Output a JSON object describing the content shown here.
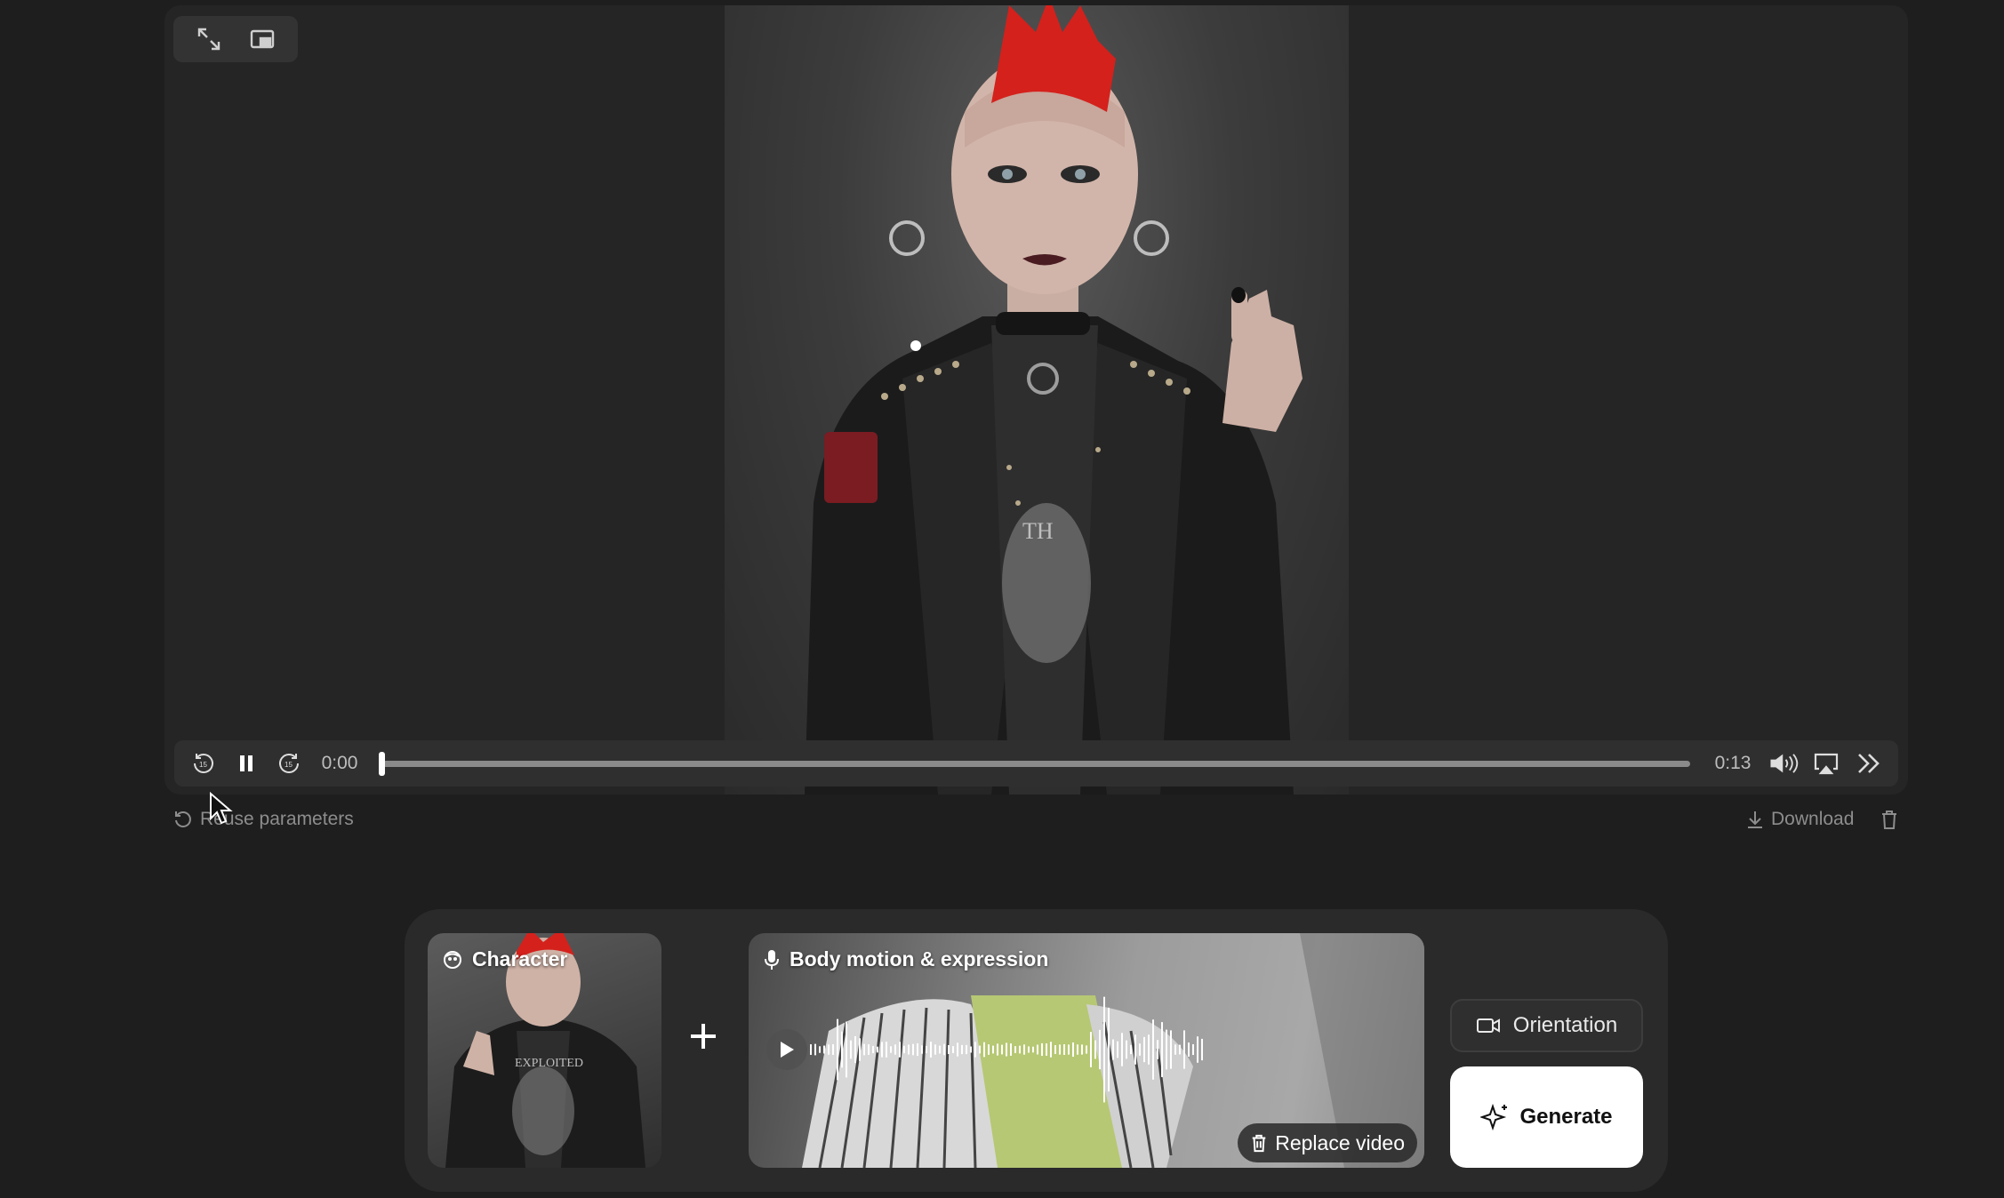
{
  "player": {
    "time_current": "0:00",
    "time_total": "0:13",
    "progress": 0
  },
  "below_player": {
    "reuse_label": "Reuse parameters",
    "download_label": "Download"
  },
  "composer": {
    "character_label": "Character",
    "motion_label": "Body motion & expression",
    "replace_label": "Replace video",
    "orientation_label": "Orientation",
    "generate_label": "Generate",
    "thumbnail_shirt_text": "EXPLOITED"
  },
  "icons": {
    "expand": "expand-icon",
    "pip": "picture-in-picture-icon",
    "rewind": "rewind-15-icon",
    "pause": "pause-icon",
    "forward": "forward-15-icon",
    "volume": "volume-icon",
    "airplay": "airplay-icon",
    "speed": "playback-speed-icon",
    "reuse": "refresh-icon",
    "download": "download-icon",
    "trash": "trash-icon",
    "character": "face-icon",
    "mic": "microphone-icon",
    "play": "play-icon",
    "camera": "video-camera-icon",
    "sparkle": "sparkle-icon"
  },
  "colors": {
    "background": "#1e1e1e",
    "accent_hair": "#d4211c",
    "generate_bg": "#ffffff"
  }
}
